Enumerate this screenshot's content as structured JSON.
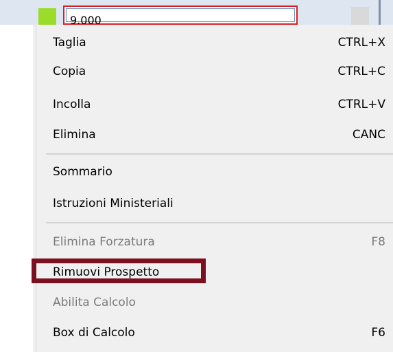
{
  "field": {
    "value": "9.000"
  },
  "menu": {
    "items": [
      {
        "label": "Taglia",
        "shortcut": "CTRL+X",
        "enabled": true
      },
      {
        "label": "Copia",
        "shortcut": "CTRL+C",
        "enabled": true
      },
      {
        "label": "Incolla",
        "shortcut": "CTRL+V",
        "enabled": true
      },
      {
        "label": "Elimina",
        "shortcut": "CANC",
        "enabled": true
      },
      {
        "label": "Sommario",
        "shortcut": "",
        "enabled": true
      },
      {
        "label": "Istruzioni Ministeriali",
        "shortcut": "",
        "enabled": true
      },
      {
        "label": "Elimina Forzatura",
        "shortcut": "F8",
        "enabled": false
      },
      {
        "label": "Rimuovi Prospetto",
        "shortcut": "",
        "enabled": true
      },
      {
        "label": "Abilita Calcolo",
        "shortcut": "",
        "enabled": false
      },
      {
        "label": "Box di Calcolo",
        "shortcut": "F6",
        "enabled": true
      }
    ]
  },
  "colors": {
    "highlight_frame": "#7a1020",
    "field_border": "#d92020",
    "status_square": "#9bdc2a"
  }
}
